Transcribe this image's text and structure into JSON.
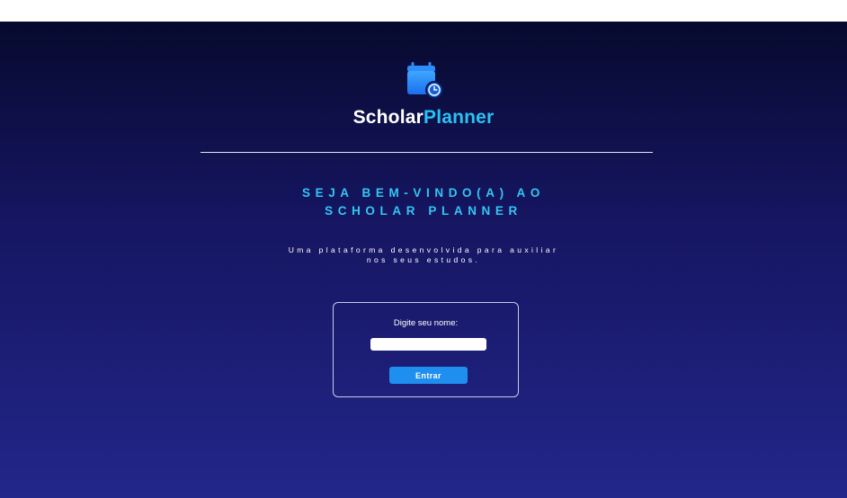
{
  "brand": {
    "name_part1": "Scholar",
    "name_part2": "Planner",
    "logo_icon": "calendar-clock-icon",
    "accent_color": "#29c2f5"
  },
  "welcome": {
    "line1": "SEJA BEM-VINDO(A) AO",
    "line2": "SCHOLAR PLANNER"
  },
  "subtitle": {
    "line1": "Uma plataforma desenvolvida para auxiliar",
    "line2": "nos seus estudos."
  },
  "login": {
    "label": "Digite seu nome:",
    "input_value": "",
    "button_label": "Entrar",
    "button_color": "#1e8fef"
  }
}
